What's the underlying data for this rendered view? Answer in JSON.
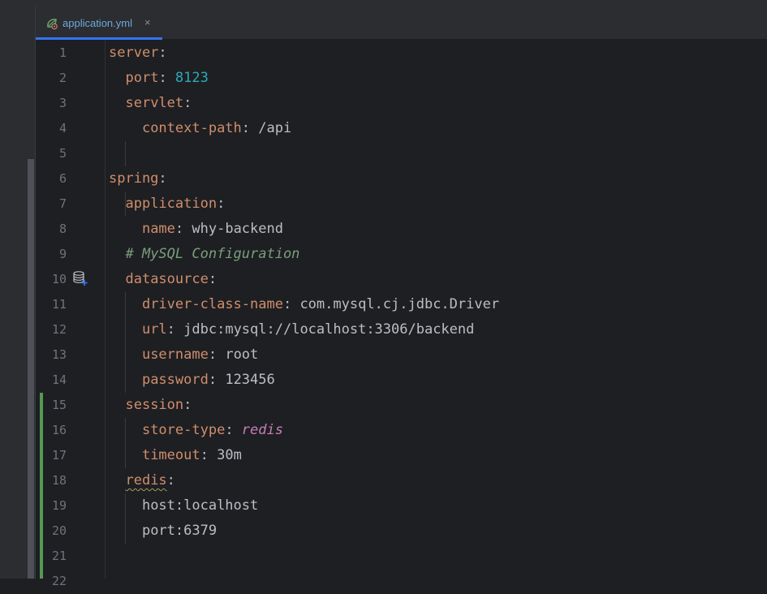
{
  "tab": {
    "filename": "application.yml",
    "close_glyph": "×",
    "icon": "spring-leaf-icon"
  },
  "gutter": {
    "line_numbers": [
      "1",
      "2",
      "3",
      "4",
      "5",
      "6",
      "7",
      "8",
      "9",
      "10",
      "11",
      "12",
      "13",
      "14",
      "15",
      "16",
      "17",
      "18",
      "19",
      "20",
      "21",
      "22"
    ],
    "db_icon_line": "10",
    "db_icon": "database-add-icon"
  },
  "code": {
    "l1": {
      "key": "server",
      "sep": ":"
    },
    "l2": {
      "key": "port",
      "sep": ": ",
      "value": "8123"
    },
    "l3": {
      "key": "servlet",
      "sep": ":"
    },
    "l4": {
      "key": "context-path",
      "sep": ": ",
      "value": "/api"
    },
    "l6": {
      "key": "spring",
      "sep": ":"
    },
    "l7": {
      "key": "application",
      "sep": ":"
    },
    "l8": {
      "key": "name",
      "sep": ": ",
      "value": "why-backend"
    },
    "l9": {
      "comment": "# MySQL Configuration"
    },
    "l10": {
      "key": "datasource",
      "sep": ":"
    },
    "l11": {
      "key": "driver-class-name",
      "sep": ": ",
      "value": "com.mysql.cj.jdbc.Driver"
    },
    "l12": {
      "key": "url",
      "sep": ": ",
      "value": "jdbc:mysql://localhost:3306/backend"
    },
    "l13": {
      "key": "username",
      "sep": ": ",
      "value": "root"
    },
    "l14": {
      "key": "password",
      "sep": ": ",
      "value": "123456"
    },
    "l15": {
      "key": "session",
      "sep": ":"
    },
    "l16": {
      "key": "store-type",
      "sep": ": ",
      "value": "redis"
    },
    "l17": {
      "key": "timeout",
      "sep": ": ",
      "value": "30m"
    },
    "l18": {
      "key": "redis",
      "sep": ":"
    },
    "l19": {
      "text": "host:localhost"
    },
    "l20": {
      "text": "port:6379"
    }
  },
  "colors": {
    "background": "#1e1f22",
    "key": "#cf8e6d",
    "number": "#2aacb8",
    "comment": "#7a9e7e",
    "enum_value": "#c77dbb",
    "text": "#bcbec4",
    "tab_accent": "#3574f0",
    "vcs_added": "#559955"
  }
}
